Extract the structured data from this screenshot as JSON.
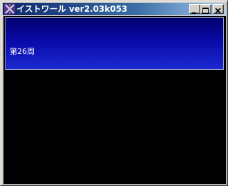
{
  "window": {
    "title": "イストワール  ver2.03k053",
    "controls": {
      "minimize_icon": "minimize-icon",
      "maximize_icon": "maximize-icon",
      "close_icon": "close-icon"
    }
  },
  "content": {
    "week_label": "第26周"
  },
  "colors": {
    "titlebar_start": "#0a246a",
    "titlebar_end": "#a6caf0",
    "banner_top": "#000070",
    "banner_bottom": "#1a2ad0",
    "client_bg": "#000000"
  }
}
